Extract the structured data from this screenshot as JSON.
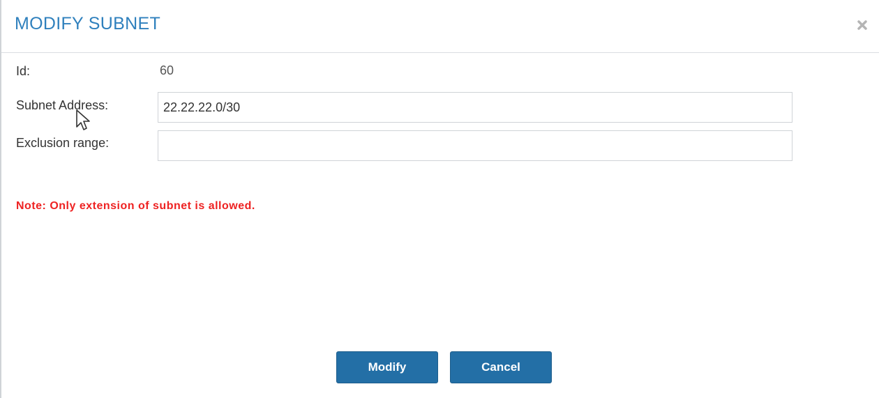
{
  "dialog": {
    "title": "MODIFY SUBNET",
    "close_icon": "close-icon"
  },
  "form": {
    "id_label": "Id:",
    "id_value": "60",
    "subnet_address_label": "Subnet Address:",
    "subnet_address_value": "22.22.22.0/30",
    "exclusion_range_label": "Exclusion range:",
    "exclusion_range_value": ""
  },
  "note": "Note: Only extension of subnet is allowed.",
  "buttons": {
    "modify_label": "Modify",
    "cancel_label": "Cancel"
  },
  "colors": {
    "title": "#2f80bd",
    "note": "#ee2222",
    "button_bg": "#236fa6",
    "button_text": "#ffffff"
  }
}
